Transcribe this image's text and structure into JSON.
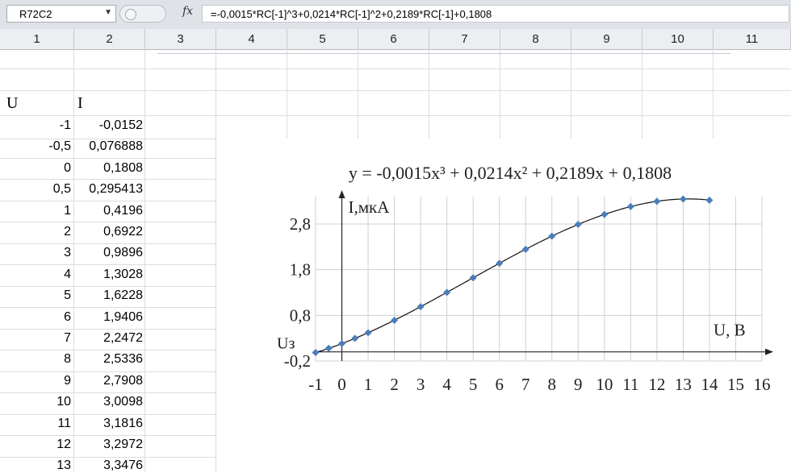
{
  "formula_bar": {
    "name_box": "R72C2",
    "fx_label": "fx",
    "formula": "=-0,0015*RC[-1]^3+0,0214*RC[-1]^2+0,2189*RC[-1]+0,1808"
  },
  "columns": [
    "1",
    "2",
    "3",
    "4",
    "5",
    "6",
    "7",
    "8",
    "9",
    "10",
    "11"
  ],
  "table": {
    "header_u": "U",
    "header_i": "I",
    "rows": [
      {
        "u": "-1",
        "i": "-0,0152"
      },
      {
        "u": "-0,5",
        "i": "0,076888"
      },
      {
        "u": "0",
        "i": "0,1808"
      },
      {
        "u": "0,5",
        "i": "0,295413"
      },
      {
        "u": "1",
        "i": "0,4196"
      },
      {
        "u": "2",
        "i": "0,6922"
      },
      {
        "u": "3",
        "i": "0,9896"
      },
      {
        "u": "4",
        "i": "1,3028"
      },
      {
        "u": "5",
        "i": "1,6228"
      },
      {
        "u": "6",
        "i": "1,9406"
      },
      {
        "u": "7",
        "i": "2,2472"
      },
      {
        "u": "8",
        "i": "2,5336"
      },
      {
        "u": "9",
        "i": "2,7908"
      },
      {
        "u": "10",
        "i": "3,0098"
      },
      {
        "u": "11",
        "i": "3,1816"
      },
      {
        "u": "12",
        "i": "3,2972"
      },
      {
        "u": "13",
        "i": "3,3476"
      }
    ]
  },
  "chart_data": {
    "type": "scatter",
    "title": "y = -0,0015x³ + 0,0214x² + 0,2189x + 0,1808",
    "xlabel": "U, B",
    "ylabel": "I,мкА",
    "origin_label": "Uз",
    "xlim": [
      -1,
      16
    ],
    "ylim": [
      -0.2,
      3.4
    ],
    "x_ticks": [
      "-1",
      "0",
      "1",
      "2",
      "3",
      "4",
      "5",
      "6",
      "7",
      "8",
      "9",
      "10",
      "11",
      "12",
      "13",
      "14",
      "15",
      "16"
    ],
    "x_tick_values": [
      -1,
      0,
      1,
      2,
      3,
      4,
      5,
      6,
      7,
      8,
      9,
      10,
      11,
      12,
      13,
      14,
      15,
      16
    ],
    "y_ticks": [
      "-0,2",
      "0,8",
      "1,8",
      "2,8"
    ],
    "y_tick_values": [
      -0.2,
      0.8,
      1.8,
      2.8
    ],
    "grid": true,
    "marker_color": "#4a7ebb",
    "trendline": {
      "type": "polynomial",
      "coefficients": [
        -0.0015,
        0.0214,
        0.2189,
        0.1808
      ]
    },
    "x": [
      -1,
      -0.5,
      0,
      0.5,
      1,
      2,
      3,
      4,
      5,
      6,
      7,
      8,
      9,
      10,
      11,
      12,
      13,
      14
    ],
    "y": [
      -0.0152,
      0.076888,
      0.1808,
      0.295413,
      0.4196,
      0.6922,
      0.9896,
      1.3028,
      1.6228,
      1.9406,
      2.2472,
      2.5336,
      2.7908,
      3.0098,
      3.1816,
      3.2972,
      3.3476,
      3.3202
    ]
  }
}
